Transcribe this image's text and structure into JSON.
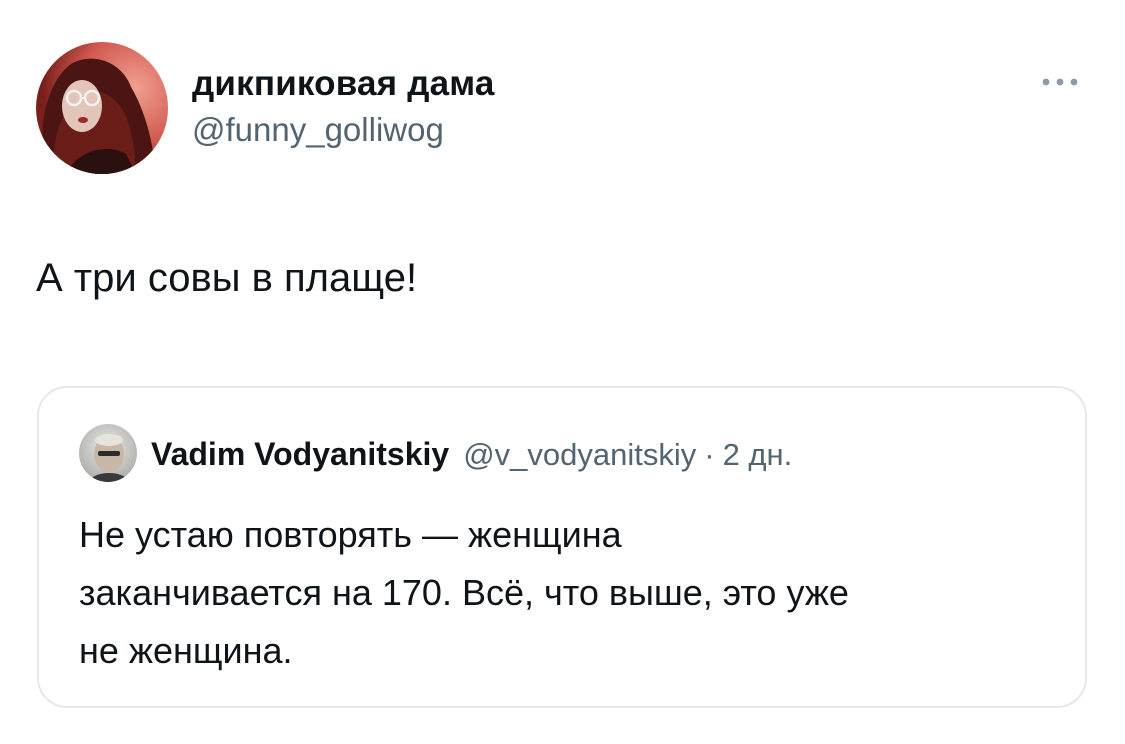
{
  "tweet": {
    "author_name": "дикпиковая дама",
    "author_handle": "@funny_golliwog",
    "text": "А три совы в плаще!",
    "more_icon": "more-horizontal-icon"
  },
  "quoted_tweet": {
    "author_name": "Vadim Vodyanitskiy",
    "author_handle": "@v_vodyanitskiy",
    "separator": "·",
    "time": "2 дн.",
    "text_lines": [
      "Не устаю повторять — женщина",
      "заканчивается на 170. Всё, что выше, это уже",
      "не женщина."
    ]
  },
  "colors": {
    "text_primary": "#0f1419",
    "text_secondary": "#536471",
    "border": "#e5e8eb"
  }
}
